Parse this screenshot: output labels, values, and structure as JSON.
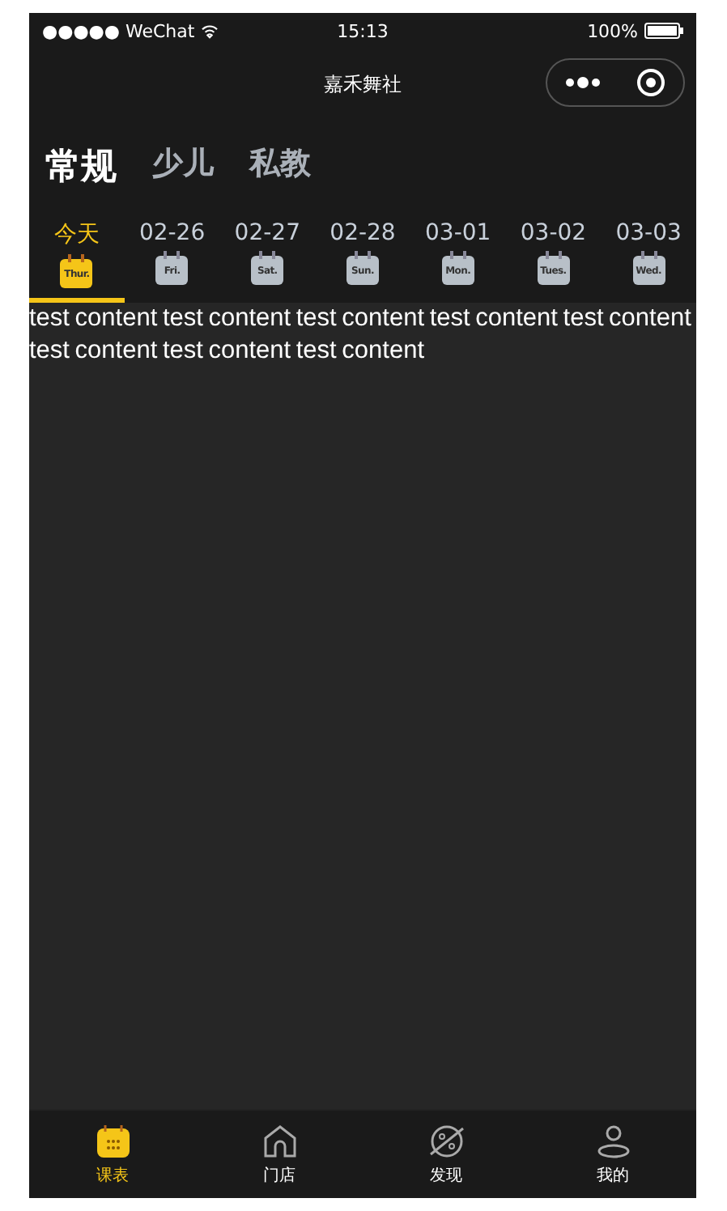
{
  "status_bar": {
    "carrier": "●●●●● WeChat",
    "time": "15:13",
    "battery": "100%"
  },
  "nav_bar": {
    "title": "嘉禾舞社"
  },
  "category_tabs": [
    {
      "label": "常规",
      "selected": true
    },
    {
      "label": "少儿",
      "selected": false
    },
    {
      "label": "私教",
      "selected": false
    }
  ],
  "dates": [
    {
      "label": "今天",
      "weekday": "Thur.",
      "selected": true
    },
    {
      "label": "02-26",
      "weekday": "Fri.",
      "selected": false
    },
    {
      "label": "02-27",
      "weekday": "Sat.",
      "selected": false
    },
    {
      "label": "02-28",
      "weekday": "Sun.",
      "selected": false
    },
    {
      "label": "03-01",
      "weekday": "Mon.",
      "selected": false
    },
    {
      "label": "03-02",
      "weekday": "Tues.",
      "selected": false
    },
    {
      "label": "03-03",
      "weekday": "Wed.",
      "selected": false
    }
  ],
  "content": "test content test content test content test content test content test content test content test content",
  "tab_bar": [
    {
      "label": "课表",
      "kind": "calendar",
      "selected": true
    },
    {
      "label": "门店",
      "kind": "home",
      "selected": false
    },
    {
      "label": "发现",
      "kind": "discover",
      "selected": false
    },
    {
      "label": "我的",
      "kind": "profile",
      "selected": false
    }
  ]
}
